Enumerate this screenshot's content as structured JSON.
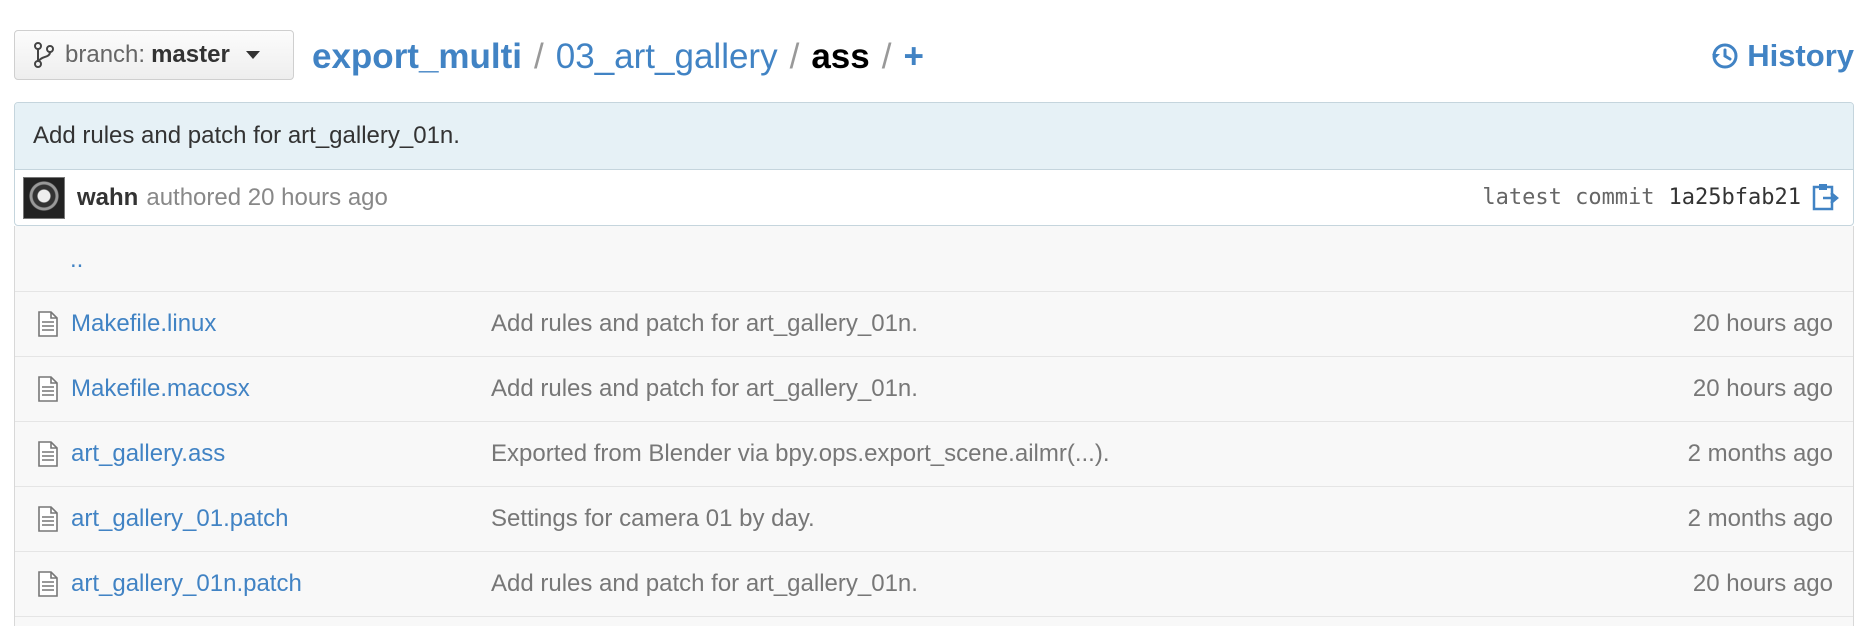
{
  "colors": {
    "link": "#4183c4",
    "commit_bg": "#e6f1f6",
    "list_bg": "#f8f8f8",
    "muted": "#777777"
  },
  "branch": {
    "prefix": "branch:",
    "name": "master",
    "icon": "branch-icon"
  },
  "breadcrumb": {
    "repo": "export_multi",
    "separator": "/",
    "dir": "03_art_gallery",
    "current": "ass",
    "add": "+"
  },
  "history": {
    "label": "History",
    "icon": "history-icon"
  },
  "commit": {
    "message": "Add rules and patch for art_gallery_01n.",
    "author": "wahn",
    "authored_text": "authored 20 hours ago",
    "latest_label": "latest commit",
    "sha": "1a25bfab21",
    "copy_icon": "clipboard-icon"
  },
  "files": {
    "up": "..",
    "rows": [
      {
        "name": "Makefile.linux",
        "message": "Add rules and patch for art_gallery_01n.",
        "age": "20 hours ago"
      },
      {
        "name": "Makefile.macosx",
        "message": "Add rules and patch for art_gallery_01n.",
        "age": "20 hours ago"
      },
      {
        "name": "art_gallery.ass",
        "message": "Exported from Blender via bpy.ops.export_scene.ailmr(...).",
        "age": "2 months ago"
      },
      {
        "name": "art_gallery_01.patch",
        "message": "Settings for camera 01 by day.",
        "age": "2 months ago"
      },
      {
        "name": "art_gallery_01n.patch",
        "message": "Add rules and patch for art_gallery_01n.",
        "age": "20 hours ago"
      }
    ]
  }
}
